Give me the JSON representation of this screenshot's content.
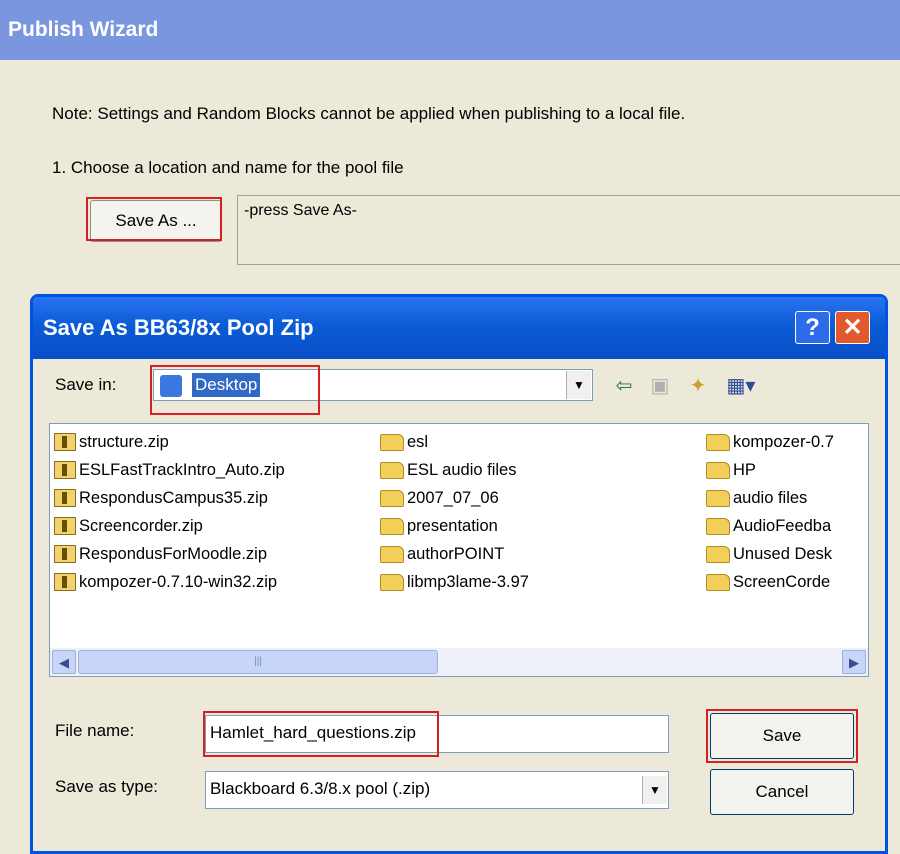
{
  "wizard": {
    "title": "Publish Wizard",
    "note": "Note: Settings and Random Blocks cannot be applied when publishing to a local file.",
    "step1": "1.  Choose a location and name for the pool file",
    "save_as_label": "Save As ...",
    "path_placeholder": "-press Save As-"
  },
  "dialog": {
    "title": "Save As BB63/8x Pool Zip",
    "help_label": "?",
    "close_label": "✕",
    "save_in_label": "Save in:",
    "save_in_value": "Desktop",
    "files_col1": [
      "structure.zip",
      "ESLFastTrackIntro_Auto.zip",
      "RespondusCampus35.zip",
      "Screencorder.zip",
      "RespondusForMoodle.zip",
      "kompozer-0.7.10-win32.zip"
    ],
    "files_col2": [
      "esl",
      "ESL audio files",
      "2007_07_06",
      "presentation",
      "authorPOINT",
      "libmp3lame-3.97"
    ],
    "files_col3": [
      "kompozer-0.7",
      "HP",
      "audio files",
      "AudioFeedba",
      "Unused Desk",
      "ScreenCorde"
    ],
    "file_name_label": "File name:",
    "file_name_value": "Hamlet_hard_questions.zip",
    "save_type_label": "Save as type:",
    "save_type_value": "Blackboard 6.3/8.x pool (.zip)",
    "save_button": "Save",
    "cancel_button": "Cancel"
  },
  "colors": {
    "highlight": "#D42020",
    "titlebar": "#0A5CD6",
    "selection": "#316AC5"
  }
}
